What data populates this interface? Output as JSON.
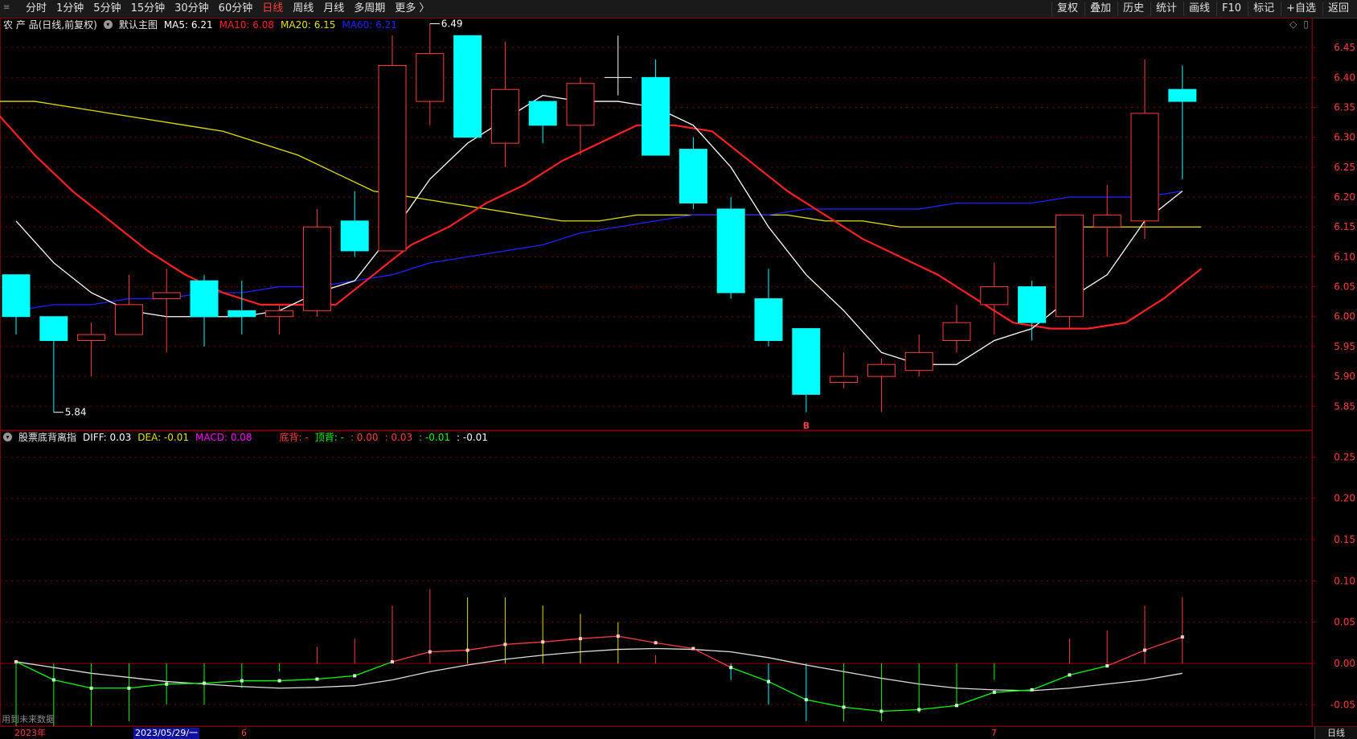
{
  "toolbar": {
    "periods": [
      {
        "label": "分时",
        "active": false
      },
      {
        "label": "1分钟",
        "active": false
      },
      {
        "label": "5分钟",
        "active": false
      },
      {
        "label": "15分钟",
        "active": false
      },
      {
        "label": "30分钟",
        "active": false
      },
      {
        "label": "60分钟",
        "active": false
      },
      {
        "label": "日线",
        "active": true
      },
      {
        "label": "周线",
        "active": false
      },
      {
        "label": "月线",
        "active": false
      },
      {
        "label": "多周期",
        "active": false
      },
      {
        "label": "更多 〉",
        "active": false
      }
    ],
    "tools": [
      "复权",
      "叠加",
      "历史",
      "统计",
      "画线",
      "F10",
      "标记",
      "+自选",
      "返回"
    ]
  },
  "main_info": {
    "name": "农 产 品(日线,前复权)",
    "template": "默认主图",
    "ma5": "MA5: 6.21",
    "ma10": "MA10: 6.08",
    "ma20": "MA20: 6.15",
    "ma60": "MA60: 6.21"
  },
  "macd_info": {
    "name": "股票底背离指",
    "diff": "DIFF: 0.03",
    "dea": "DEA: -0.01",
    "macd": "MACD: 0.08",
    "bottom": "底背: -",
    "top": "顶背: -",
    "v1": ": 0.00",
    "v2": ": 0.03",
    "v3": ": -0.01",
    "v4": ": -0.01"
  },
  "bottom": {
    "year_label": "2023年",
    "cursor_date": "2023/05/29/一",
    "month6": "6",
    "month7": "7",
    "future_note": "用到未来数据",
    "period": "日线"
  },
  "colors": {
    "up": "#ff3b3b",
    "down": "#00ffff",
    "ma5": "#ffffff",
    "ma10": "#ff2020",
    "ma20": "#e0e000",
    "ma60": "#2020ff",
    "grid": "#7a0000",
    "axis_text": "#ff3b3b"
  },
  "chart_data": {
    "type": "candlestick",
    "price_axis": {
      "ticks": [
        "6.45",
        "6.40",
        "6.35",
        "6.30",
        "6.25",
        "6.20",
        "6.15",
        "6.10",
        "6.05",
        "6.00",
        "5.95",
        "5.90",
        "5.85"
      ],
      "ylim": [
        5.81,
        6.5
      ]
    },
    "macd_axis": {
      "ticks": [
        "0.25",
        "0.20",
        "0.15",
        "0.10",
        "0.05",
        "0.00",
        "-0.05"
      ],
      "ylim": [
        -0.076,
        0.265
      ]
    },
    "annotations": {
      "high": "6.49",
      "low": "5.84",
      "signal": "B"
    },
    "candles": [
      {
        "o": 6.07,
        "c": 6.0,
        "h": 6.07,
        "l": 5.97
      },
      {
        "o": 6.0,
        "c": 5.96,
        "h": 6.0,
        "l": 5.84
      },
      {
        "o": 5.96,
        "c": 5.97,
        "h": 5.99,
        "l": 5.9
      },
      {
        "o": 5.97,
        "c": 6.02,
        "h": 6.07,
        "l": 5.97
      },
      {
        "o": 6.03,
        "c": 6.04,
        "h": 6.08,
        "l": 5.94
      },
      {
        "o": 6.06,
        "c": 6.0,
        "h": 6.07,
        "l": 5.95
      },
      {
        "o": 6.01,
        "c": 6.0,
        "h": 6.06,
        "l": 5.97
      },
      {
        "o": 6.0,
        "c": 6.01,
        "h": 6.02,
        "l": 5.97
      },
      {
        "o": 6.01,
        "c": 6.15,
        "h": 6.18,
        "l": 6.0
      },
      {
        "o": 6.16,
        "c": 6.11,
        "h": 6.21,
        "l": 6.1
      },
      {
        "o": 6.11,
        "c": 6.42,
        "h": 6.47,
        "l": 6.11
      },
      {
        "o": 6.36,
        "c": 6.44,
        "h": 6.49,
        "l": 6.32
      },
      {
        "o": 6.47,
        "c": 6.3,
        "h": 6.47,
        "l": 6.3
      },
      {
        "o": 6.29,
        "c": 6.38,
        "h": 6.46,
        "l": 6.25
      },
      {
        "o": 6.36,
        "c": 6.32,
        "h": 6.36,
        "l": 6.29
      },
      {
        "o": 6.32,
        "c": 6.39,
        "h": 6.4,
        "l": 6.27
      },
      {
        "o": 6.4,
        "c": 6.4,
        "h": 6.47,
        "l": 6.37
      },
      {
        "o": 6.4,
        "c": 6.27,
        "h": 6.43,
        "l": 6.27
      },
      {
        "o": 6.28,
        "c": 6.19,
        "h": 6.3,
        "l": 6.18
      },
      {
        "o": 6.18,
        "c": 6.04,
        "h": 6.2,
        "l": 6.03
      },
      {
        "o": 6.03,
        "c": 5.96,
        "h": 6.08,
        "l": 5.95
      },
      {
        "o": 5.98,
        "c": 5.87,
        "h": 5.98,
        "l": 5.84
      },
      {
        "o": 5.89,
        "c": 5.9,
        "h": 5.94,
        "l": 5.88
      },
      {
        "o": 5.9,
        "c": 5.92,
        "h": 5.93,
        "l": 5.84
      },
      {
        "o": 5.91,
        "c": 5.94,
        "h": 5.97,
        "l": 5.9
      },
      {
        "o": 5.96,
        "c": 5.99,
        "h": 6.02,
        "l": 5.94
      },
      {
        "o": 6.02,
        "c": 6.05,
        "h": 6.09,
        "l": 5.97
      },
      {
        "o": 6.05,
        "c": 5.99,
        "h": 6.06,
        "l": 5.96
      },
      {
        "o": 6.0,
        "c": 6.17,
        "h": 6.17,
        "l": 5.98
      },
      {
        "o": 6.15,
        "c": 6.17,
        "h": 6.22,
        "l": 6.1
      },
      {
        "o": 6.16,
        "c": 6.34,
        "h": 6.43,
        "l": 6.13
      },
      {
        "o": 6.38,
        "c": 6.36,
        "h": 6.42,
        "l": 6.23
      }
    ],
    "ma5": [
      6.16,
      6.09,
      6.04,
      6.01,
      6.0,
      6.0,
      6.0,
      6.01,
      6.04,
      6.06,
      6.14,
      6.23,
      6.29,
      6.33,
      6.37,
      6.36,
      6.36,
      6.35,
      6.32,
      6.25,
      6.15,
      6.07,
      6.01,
      5.94,
      5.92,
      5.92,
      5.96,
      5.98,
      6.03,
      6.07,
      6.16,
      6.21
    ],
    "ma10": [
      6.34,
      6.27,
      6.21,
      6.16,
      6.11,
      6.07,
      6.04,
      6.02,
      6.02,
      6.02,
      6.07,
      6.12,
      6.15,
      6.19,
      6.22,
      6.26,
      6.29,
      6.32,
      6.32,
      6.31,
      6.26,
      6.21,
      6.17,
      6.13,
      6.1,
      6.07,
      6.03,
      5.99,
      5.98,
      5.98,
      5.99,
      6.03,
      6.08
    ],
    "ma20": [
      6.36,
      6.36,
      6.35,
      6.34,
      6.33,
      6.32,
      6.31,
      6.29,
      6.27,
      6.24,
      6.21,
      6.2,
      6.19,
      6.18,
      6.17,
      6.16,
      6.16,
      6.17,
      6.17,
      6.17,
      6.17,
      6.17,
      6.16,
      6.16,
      6.15,
      6.15,
      6.15,
      6.15,
      6.15,
      6.15,
      6.15,
      6.15,
      6.15
    ],
    "ma60": [
      6.01,
      6.02,
      6.02,
      6.03,
      6.03,
      6.04,
      6.04,
      6.05,
      6.05,
      6.06,
      6.07,
      6.09,
      6.1,
      6.11,
      6.12,
      6.14,
      6.15,
      6.16,
      6.17,
      6.17,
      6.17,
      6.18,
      6.18,
      6.18,
      6.18,
      6.19,
      6.19,
      6.19,
      6.2,
      6.2,
      6.2,
      6.21
    ],
    "diff": [
      0.002,
      -0.005,
      -0.012,
      -0.017,
      -0.022,
      -0.025,
      -0.028,
      -0.03,
      -0.029,
      -0.027,
      -0.02,
      -0.01,
      -0.002,
      0.005,
      0.01,
      0.014,
      0.017,
      0.018,
      0.017,
      0.014,
      0.007,
      -0.002,
      -0.01,
      -0.018,
      -0.025,
      -0.03,
      -0.032,
      -0.033,
      -0.03,
      -0.025,
      -0.02,
      -0.012
    ],
    "dea": [
      0.002,
      -0.02,
      -0.03,
      -0.03,
      -0.025,
      -0.024,
      -0.021,
      -0.021,
      -0.019,
      -0.015,
      0.002,
      0.014,
      0.016,
      0.023,
      0.026,
      0.03,
      0.033,
      0.025,
      0.018,
      -0.005,
      -0.022,
      -0.044,
      -0.053,
      -0.058,
      -0.056,
      -0.051,
      -0.035,
      -0.032,
      -0.014,
      -0.003,
      0.016,
      0.032
    ],
    "macd": [
      -0.08,
      -0.09,
      -0.09,
      -0.07,
      -0.05,
      -0.05,
      -0.03,
      -0.01,
      0.02,
      0.03,
      0.07,
      0.09,
      0.08,
      0.08,
      0.07,
      0.06,
      0.05,
      0.01,
      0.0,
      -0.02,
      -0.05,
      -0.07,
      -0.07,
      -0.07,
      -0.06,
      -0.05,
      -0.02,
      0.0,
      0.03,
      0.04,
      0.07,
      0.08
    ]
  }
}
